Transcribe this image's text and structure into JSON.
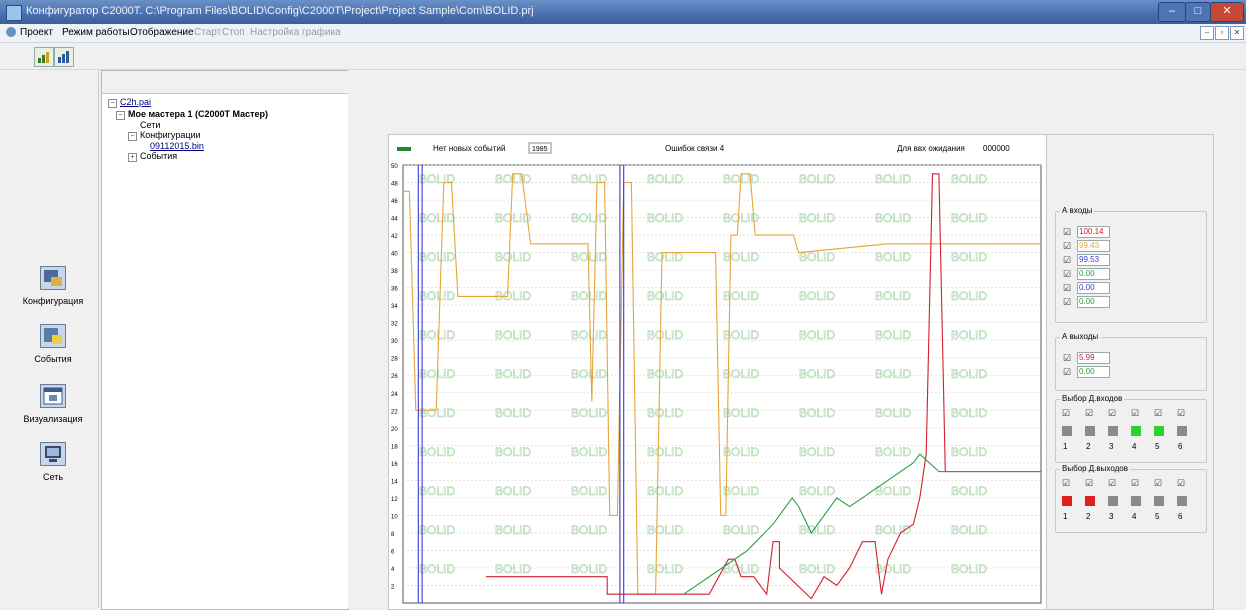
{
  "window": {
    "title": "Конфигуратор С2000Т. C:\\Program Files\\BOLID\\Config\\C2000T\\Project\\Project Sample\\Com\\BOLID.prj",
    "min": "–",
    "max": "□",
    "close": "✕"
  },
  "menu": {
    "items": [
      "Проект",
      "Режим работы",
      "Отображение",
      "Старт",
      "Стоп",
      "Настройка графика"
    ],
    "disabled": [
      false,
      false,
      false,
      true,
      true,
      true
    ]
  },
  "toolbar": {
    "btn1": "chart-add-icon",
    "btn2": "chart-icon"
  },
  "nav": {
    "configuration": "Конфигурация",
    "events": "События",
    "visualization": "Визуализация",
    "networks": "Сеть"
  },
  "tree": {
    "root": "C2h.pai",
    "master": "Мое мастера 1 (С2000Т Мастер)",
    "networks": "Сети",
    "configurations": "Конфигурации",
    "config_file": "09112015.bin",
    "events": "События"
  },
  "chart_header": {
    "no_events": "Нет новых событий",
    "counter": "1985",
    "errors": "Ошибок связи 4",
    "time_label": "Для ввх ожидания",
    "time_value": "000000"
  },
  "chart_data": {
    "type": "line",
    "ylim": [
      0,
      50
    ],
    "yticks": [
      2,
      4,
      6,
      8,
      10,
      12,
      14,
      16,
      18,
      20,
      22,
      24,
      26,
      28,
      30,
      32,
      34,
      36,
      38,
      40,
      42,
      44,
      46,
      48,
      50
    ],
    "watermark": "BOLID",
    "series": [
      {
        "color": "#e5a53a",
        "points": [
          [
            0,
            47
          ],
          [
            0.5,
            47
          ],
          [
            1,
            22
          ],
          [
            2.6,
            22
          ],
          [
            3.2,
            48
          ],
          [
            3.8,
            48
          ],
          [
            4.3,
            35
          ],
          [
            8.2,
            35
          ],
          [
            8.6,
            49
          ],
          [
            9.3,
            49
          ],
          [
            10,
            41
          ],
          [
            12.3,
            41
          ],
          [
            14.5,
            41
          ],
          [
            14.8,
            23
          ],
          [
            15.2,
            48
          ],
          [
            15.8,
            48
          ],
          [
            16.2,
            10
          ],
          [
            16.8,
            10
          ],
          [
            17.3,
            48
          ],
          [
            17.9,
            48
          ],
          [
            18.4,
            1
          ],
          [
            19.8,
            1
          ],
          [
            20.3,
            40
          ],
          [
            21,
            40
          ],
          [
            24.5,
            40
          ],
          [
            24.9,
            10
          ],
          [
            25.3,
            10
          ],
          [
            25.7,
            42
          ],
          [
            26.2,
            42
          ],
          [
            26.5,
            49
          ],
          [
            27.2,
            49
          ],
          [
            27.6,
            42
          ],
          [
            30.6,
            42
          ],
          [
            31,
            40
          ],
          [
            38,
            41
          ],
          [
            50,
            41
          ]
        ]
      },
      {
        "color": "#d0202a",
        "points": [
          [
            6.5,
            3
          ],
          [
            16,
            3
          ],
          [
            16,
            1
          ],
          [
            21,
            1
          ],
          [
            22,
            1
          ],
          [
            24,
            1
          ],
          [
            25.5,
            5
          ],
          [
            26,
            5
          ],
          [
            26.5,
            3
          ],
          [
            27.5,
            3
          ],
          [
            28.5,
            1
          ],
          [
            29,
            7
          ],
          [
            29.5,
            7
          ],
          [
            29.5,
            4
          ],
          [
            32,
            0.5
          ],
          [
            33,
            3
          ],
          [
            34,
            2
          ],
          [
            35,
            4
          ],
          [
            36,
            7
          ],
          [
            37,
            7
          ],
          [
            37.5,
            1
          ],
          [
            38,
            5
          ],
          [
            39,
            8
          ],
          [
            40,
            9
          ],
          [
            40.5,
            12
          ],
          [
            41,
            17
          ],
          [
            41.5,
            49
          ],
          [
            42,
            49
          ],
          [
            42.5,
            15
          ],
          [
            44,
            15
          ],
          [
            50,
            15
          ]
        ]
      },
      {
        "color": "#2fa040",
        "points": [
          [
            22,
            1
          ],
          [
            25,
            4
          ],
          [
            27,
            6
          ],
          [
            29,
            9
          ],
          [
            30.5,
            12
          ],
          [
            31,
            11
          ],
          [
            32,
            8
          ],
          [
            33,
            10
          ],
          [
            34,
            12
          ],
          [
            35,
            11
          ],
          [
            36,
            12
          ],
          [
            37,
            13
          ],
          [
            38,
            14
          ],
          [
            39,
            15
          ],
          [
            40,
            16
          ],
          [
            40.5,
            17
          ],
          [
            42,
            15
          ],
          [
            44,
            15
          ],
          [
            50,
            15
          ]
        ]
      },
      {
        "color": "#3b3bd6",
        "points": [
          [
            1.2,
            50
          ],
          [
            1.2,
            0
          ],
          [
            1.5,
            0
          ],
          [
            1.5,
            50
          ]
        ]
      },
      {
        "color": "#3b3bd6",
        "points": [
          [
            17,
            50
          ],
          [
            17,
            0
          ],
          [
            17.3,
            0
          ],
          [
            17.3,
            50
          ]
        ]
      }
    ]
  },
  "analog_in": {
    "title": "А входы",
    "values": [
      "100.14",
      "99.43",
      "99.53",
      "0.00",
      "0.00",
      "0.00"
    ],
    "colors": [
      "#d0202a",
      "#e5a53a",
      "#3b3bd6",
      "#2fa040",
      "#3b3bd6",
      "#2fa040"
    ]
  },
  "analog_out": {
    "title": "А выходы",
    "values": [
      "5.99",
      "0.00"
    ],
    "colors": [
      "#d0202a",
      "#2fa040"
    ]
  },
  "discrete_in": {
    "title": "Выбор Д.входов",
    "numbers": [
      "1",
      "2",
      "3",
      "4",
      "5",
      "6"
    ],
    "states": [
      "#8a8a8a",
      "#8a8a8a",
      "#8a8a8a",
      "#30d030",
      "#30d030",
      "#8a8a8a"
    ]
  },
  "discrete_out": {
    "title": "Выбор Д.выходов",
    "numbers": [
      "1",
      "2",
      "3",
      "4",
      "5",
      "6"
    ],
    "states": [
      "#e02020",
      "#e02020",
      "#8a8a8a",
      "#8a8a8a",
      "#8a8a8a",
      "#8a8a8a"
    ]
  }
}
